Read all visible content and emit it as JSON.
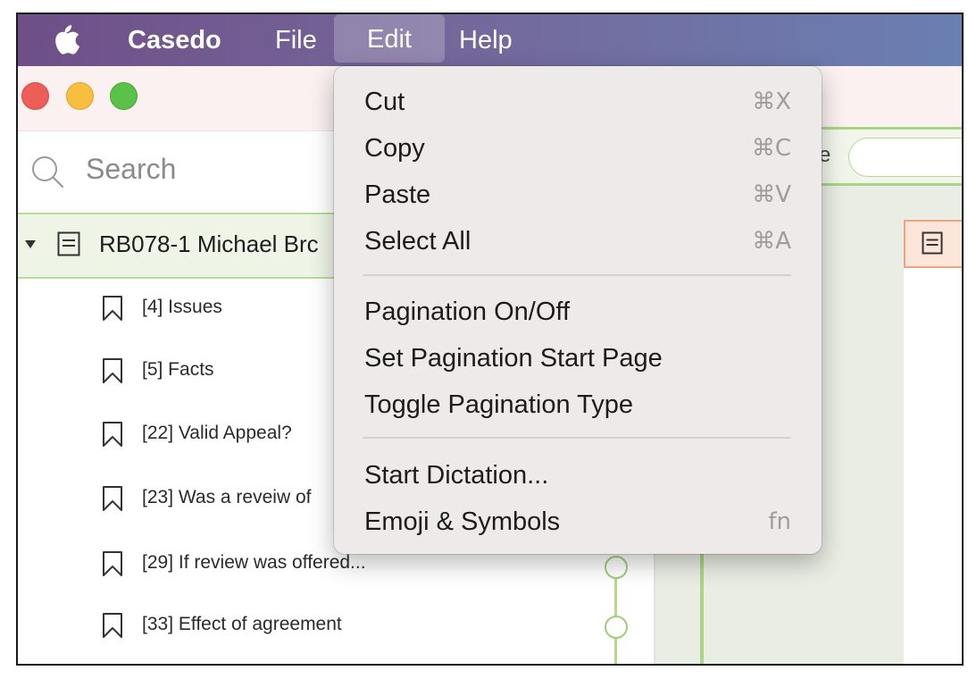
{
  "menubar": {
    "app_name": "Casedo",
    "menus": [
      "File",
      "Edit",
      "Help"
    ]
  },
  "sidebar": {
    "search_placeholder": "Search",
    "document_title": "RB078-1 Michael Brc",
    "bookmarks": [
      "[4] Issues",
      "[5] Facts",
      "[22] Valid Appeal?",
      "[23] Was a reveiw of",
      "[29] If review was offered...",
      "[33] Effect of agreement"
    ]
  },
  "right_panel": {
    "field_fragment": "e"
  },
  "edit_menu": {
    "groups": [
      [
        {
          "label": "Cut",
          "shortcut": "⌘X"
        },
        {
          "label": "Copy",
          "shortcut": "⌘C"
        },
        {
          "label": "Paste",
          "shortcut": "⌘V"
        },
        {
          "label": "Select All",
          "shortcut": "⌘A"
        }
      ],
      [
        {
          "label": "Pagination On/Off",
          "shortcut": ""
        },
        {
          "label": "Set Pagination Start Page",
          "shortcut": ""
        },
        {
          "label": "Toggle Pagination Type",
          "shortcut": ""
        }
      ],
      [
        {
          "label": "Start Dictation...",
          "shortcut": ""
        },
        {
          "label": "Emoji & Symbols",
          "shortcut": "fn"
        }
      ]
    ]
  },
  "colors": {
    "menubar_start": "#6e4f87",
    "menubar_end": "#6a7fb2",
    "accent_green": "#a9d587",
    "selected_row_bg": "#eef4e6",
    "menu_bg": "#efeaea"
  }
}
